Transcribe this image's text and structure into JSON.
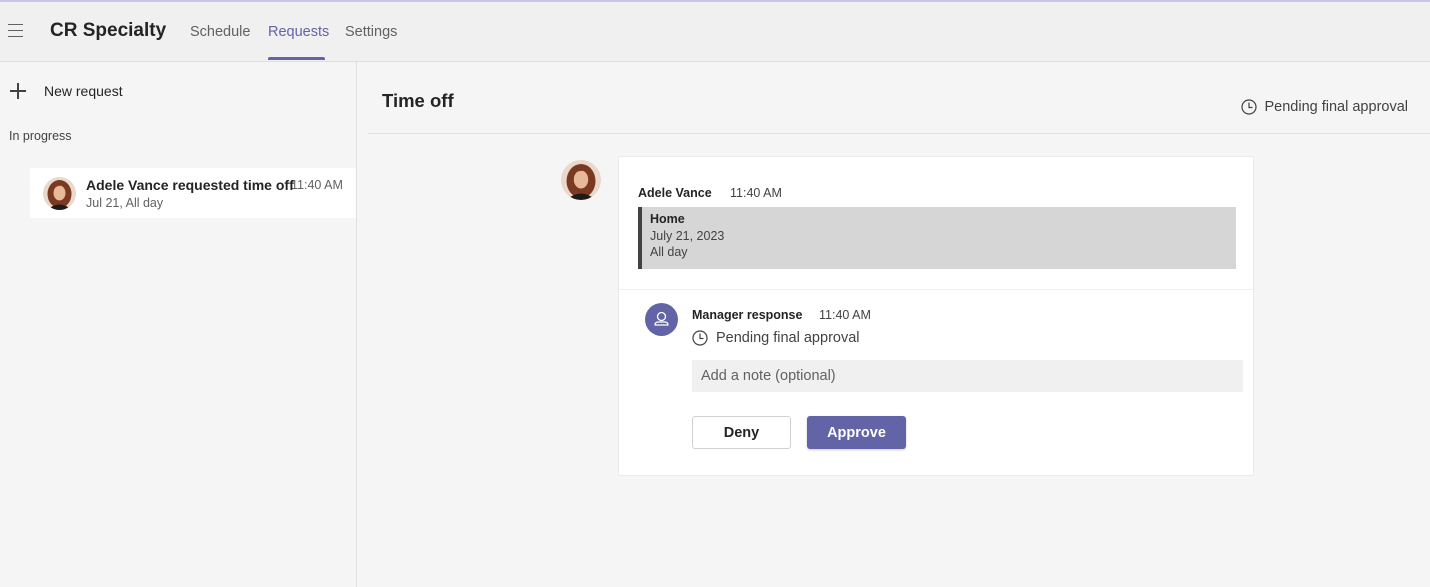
{
  "app": {
    "title": "CR Specialty",
    "tabs": [
      {
        "label": "Schedule",
        "active": false
      },
      {
        "label": "Requests",
        "active": true
      },
      {
        "label": "Settings",
        "active": false
      }
    ]
  },
  "sidebar": {
    "new_request_label": "New request",
    "section_label": "In progress",
    "requests": [
      {
        "title": "Adele Vance requested time off",
        "time": "11:40 AM",
        "subtitle": "Jul 21, All day"
      }
    ]
  },
  "detail": {
    "title": "Time off",
    "status": "Pending final approval",
    "message": {
      "sender": "Adele Vance",
      "time": "11:40 AM",
      "quote": {
        "title": "Home",
        "date": "July 21, 2023",
        "duration": "All day"
      }
    },
    "manager": {
      "label": "Manager response",
      "time": "11:40 AM",
      "status": "Pending final approval",
      "note_placeholder": "Add a note (optional)",
      "deny_label": "Deny",
      "approve_label": "Approve"
    }
  },
  "colors": {
    "accent": "#6264a7",
    "background": "#f5f5f5",
    "card": "#ffffff",
    "quote_bg": "#d6d6d6"
  },
  "icons": [
    "hamburger-menu-icon",
    "plus-icon",
    "clock-icon",
    "person-icon"
  ]
}
